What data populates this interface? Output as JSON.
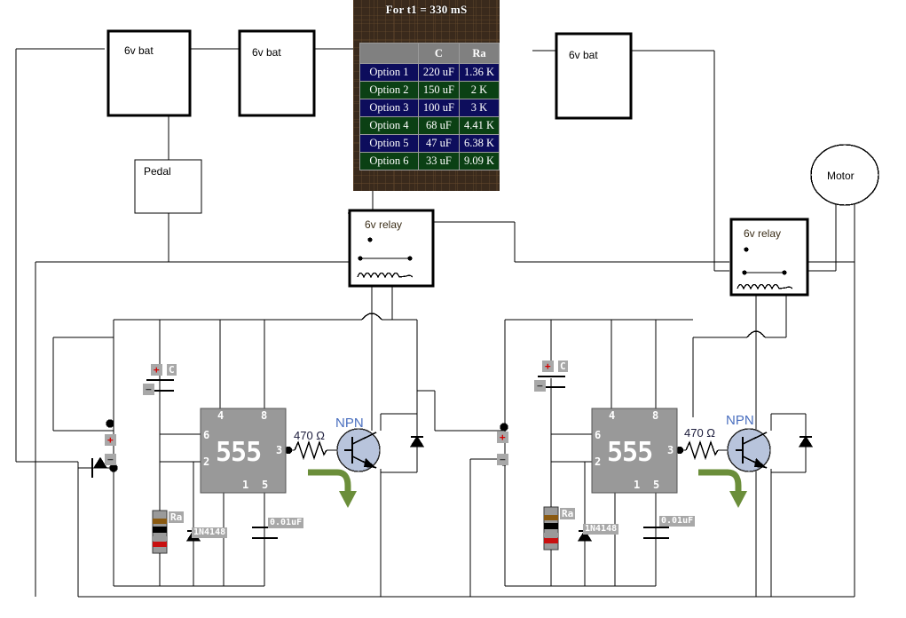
{
  "panel": {
    "title": "For t1 = 330 mS",
    "table": {
      "headers": [
        "",
        "C",
        "Ra"
      ],
      "rows": [
        {
          "label": "Option 1",
          "c": "220 uF",
          "ra": "1.36 K"
        },
        {
          "label": "Option 2",
          "c": "150 uF",
          "ra": "2 K"
        },
        {
          "label": "Option 3",
          "c": "100 uF",
          "ra": "3 K"
        },
        {
          "label": "Option 4",
          "c": "68 uF",
          "ra": "4.41 K"
        },
        {
          "label": "Option 5",
          "c": "47 uF",
          "ra": "6.38 K"
        },
        {
          "label": "Option 6",
          "c": "33 uF",
          "ra": "9.09 K"
        }
      ]
    }
  },
  "components": {
    "battery1": "6v bat",
    "battery2": "6v bat",
    "battery3": "6v bat",
    "pedal": "Pedal",
    "motor": "Motor",
    "relay1": "6v relay",
    "relay2": "6v relay",
    "ic1": "555",
    "ic2": "555",
    "npn1": "NPN",
    "npn2": "NPN",
    "resistor1": "470 Ω",
    "resistor2": "470 Ω",
    "ra1": "Ra",
    "ra2": "Ra",
    "cap_c1": "C",
    "cap_c2": "C",
    "cap_timing1": "0.01uF",
    "cap_timing2": "0.01uF",
    "diode1": "1N4148",
    "diode2": "1N4148",
    "plus": "+",
    "minus": "−",
    "ic_pins": [
      "4",
      "8",
      "6",
      "2",
      "3",
      "1",
      "5"
    ]
  },
  "colors": {
    "wire": "#000000",
    "ic_body": "#999999",
    "transistor_body": "#b8c4dc",
    "arrow_green": "#6b8e3a",
    "table_row_navy": "#0d0d5c",
    "table_row_green": "#0b4014",
    "table_header": "#808080",
    "pcb": "#3a2a1c",
    "npn_text": "#4a6fbf"
  }
}
